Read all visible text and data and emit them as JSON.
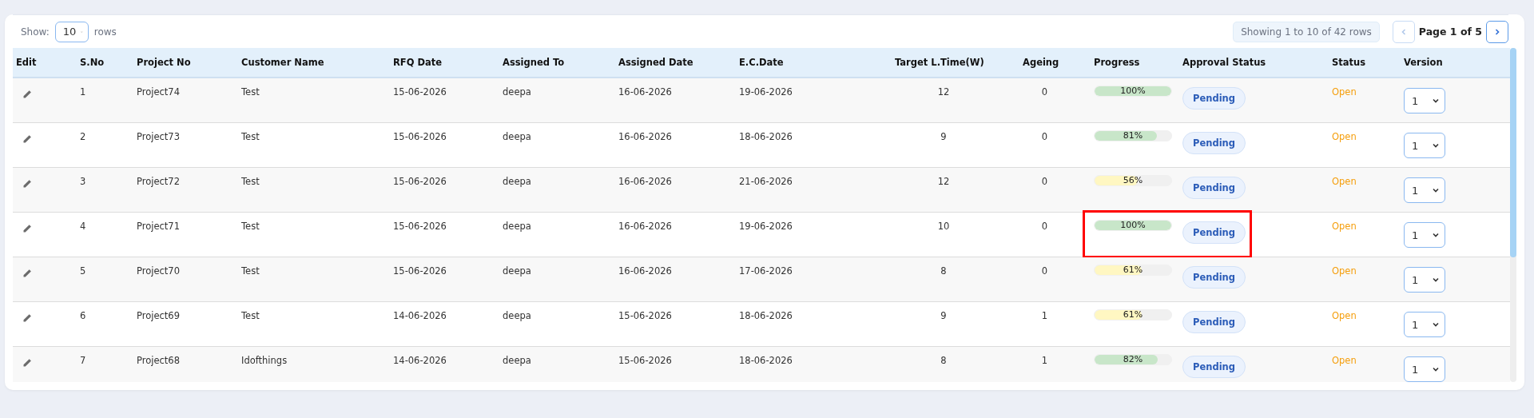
{
  "toolbar": {
    "show_label": "Show:",
    "page_size": "10",
    "rows_label": "rows",
    "showing": "Showing 1 to 10 of 42 rows",
    "prev_disabled": true,
    "page_info": "Page 1 of 5",
    "next_disabled": false
  },
  "table": {
    "columns": [
      "Edit",
      "S.No",
      "Project No",
      "Customer Name",
      "RFQ Date",
      "Assigned To",
      "Assigned Date",
      "E.C.Date",
      "Target L.Time(W)",
      "Ageing",
      "Progress",
      "Approval Status",
      "Status",
      "Version"
    ],
    "rows": [
      {
        "sno": "1",
        "project": "Project74",
        "customer": "Test",
        "rfq": "15-06-2026",
        "assigned_to": "deepa",
        "assigned_date": "16-06-2026",
        "ec_date": "19-06-2026",
        "target": "12",
        "ageing": "0",
        "progress": "100%",
        "level": 1,
        "color": "#c8e6c9",
        "approval": "Pending",
        "status": "Open",
        "version": "1",
        "highlighted": false
      },
      {
        "sno": "2",
        "project": "Project73",
        "customer": "Test",
        "rfq": "15-06-2026",
        "assigned_to": "deepa",
        "assigned_date": "16-06-2026",
        "ec_date": "18-06-2026",
        "target": "9",
        "ageing": "0",
        "progress": "81%",
        "level": 0.81,
        "color": "#c8e6c9",
        "approval": "Pending",
        "status": "Open",
        "version": "1",
        "highlighted": false
      },
      {
        "sno": "3",
        "project": "Project72",
        "customer": "Test",
        "rfq": "15-06-2026",
        "assigned_to": "deepa",
        "assigned_date": "16-06-2026",
        "ec_date": "21-06-2026",
        "target": "12",
        "ageing": "0",
        "progress": "56%",
        "level": 0.56,
        "color": "#fff7c2",
        "approval": "Pending",
        "status": "Open",
        "version": "1",
        "highlighted": false
      },
      {
        "sno": "4",
        "project": "Project71",
        "customer": "Test",
        "rfq": "15-06-2026",
        "assigned_to": "deepa",
        "assigned_date": "16-06-2026",
        "ec_date": "19-06-2026",
        "target": "10",
        "ageing": "0",
        "progress": "100%",
        "level": 1,
        "color": "#c8e6c9",
        "approval": "Pending",
        "status": "Open",
        "version": "1",
        "highlighted": true
      },
      {
        "sno": "5",
        "project": "Project70",
        "customer": "Test",
        "rfq": "15-06-2026",
        "assigned_to": "deepa",
        "assigned_date": "16-06-2026",
        "ec_date": "17-06-2026",
        "target": "8",
        "ageing": "0",
        "progress": "61%",
        "level": 0.61,
        "color": "#fff7c2",
        "approval": "Pending",
        "status": "Open",
        "version": "1",
        "highlighted": false
      },
      {
        "sno": "6",
        "project": "Project69",
        "customer": "Test",
        "rfq": "14-06-2026",
        "assigned_to": "deepa",
        "assigned_date": "15-06-2026",
        "ec_date": "18-06-2026",
        "target": "9",
        "ageing": "1",
        "progress": "61%",
        "level": 0.61,
        "color": "#fff7c2",
        "approval": "Pending",
        "status": "Open",
        "version": "1",
        "highlighted": false
      },
      {
        "sno": "7",
        "project": "Project68",
        "customer": "Idofthings",
        "rfq": "14-06-2026",
        "assigned_to": "deepa",
        "assigned_date": "15-06-2026",
        "ec_date": "18-06-2026",
        "target": "8",
        "ageing": "1",
        "progress": "82%",
        "level": 0.82,
        "color": "#c8e6c9",
        "approval": "Pending",
        "status": "Open",
        "version": "1",
        "highlighted": false
      }
    ]
  }
}
